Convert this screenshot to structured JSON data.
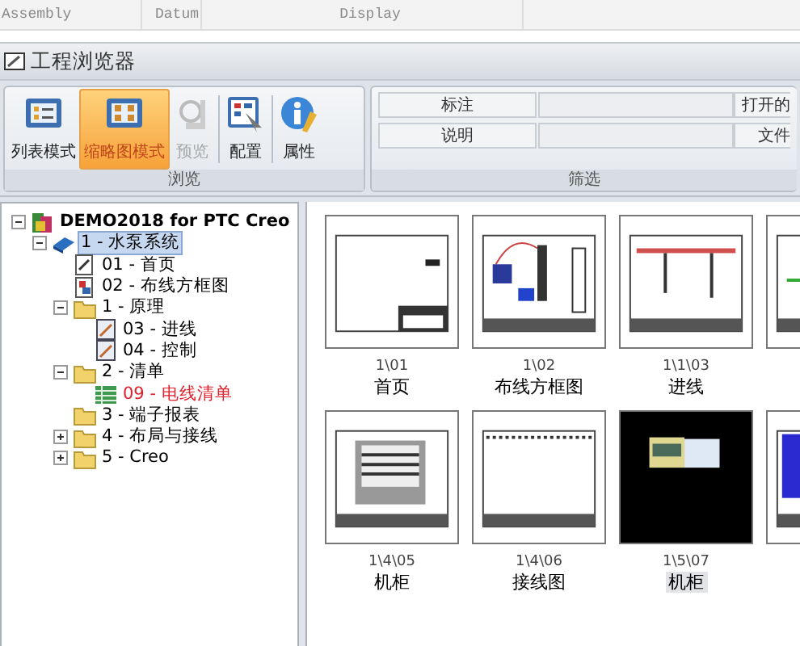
{
  "top_bar": {
    "columns": [
      "Assembly",
      "Datum",
      "Display"
    ]
  },
  "window": {
    "title": "工程浏览器"
  },
  "ribbon": {
    "browse": {
      "label": "浏览",
      "buttons": [
        {
          "label": "列表模式",
          "kind": "list",
          "selected": false,
          "disabled": false
        },
        {
          "label": "缩略图模式",
          "kind": "thumbs",
          "selected": true,
          "disabled": false
        },
        {
          "label": "预览",
          "kind": "preview",
          "selected": false,
          "disabled": true
        },
        {
          "label": "配置",
          "kind": "config",
          "selected": false,
          "disabled": false
        },
        {
          "label": "属性",
          "kind": "info",
          "selected": false,
          "disabled": false
        }
      ]
    },
    "filter": {
      "label": "筛选",
      "rows": [
        {
          "label": "标注",
          "column_3": "打开的"
        },
        {
          "label": "说明",
          "column_3": "文件"
        }
      ]
    }
  },
  "tree": [
    {
      "label": "DEMO2018 for PTC Creo",
      "kind": "project",
      "expanded": true,
      "selected": false,
      "color": "#000000",
      "children": [
        {
          "label": "1 - 水泵系统",
          "kind": "system",
          "expanded": true,
          "selected": true,
          "color": "#000000",
          "children": [
            {
              "label": "01 - 首页",
              "kind": "page",
              "selected": false,
              "color": "#000000"
            },
            {
              "label": "02 - 布线方框图",
              "kind": "diagram",
              "selected": false,
              "color": "#000000"
            },
            {
              "label": "1 - 原理",
              "kind": "folder",
              "expanded": true,
              "selected": false,
              "color": "#000000",
              "children": [
                {
                  "label": "03 - 进线",
                  "kind": "schematic",
                  "selected": false,
                  "color": "#000000"
                },
                {
                  "label": "04 - 控制",
                  "kind": "schematic",
                  "selected": false,
                  "color": "#000000"
                }
              ]
            },
            {
              "label": "2 - 清单",
              "kind": "folder",
              "expanded": true,
              "selected": false,
              "color": "#000000",
              "children": [
                {
                  "label": "09 - 电线清单",
                  "kind": "table",
                  "selected": false,
                  "color": "#e0202a"
                }
              ]
            },
            {
              "label": "3 - 端子报表",
              "kind": "folder",
              "selected": false,
              "color": "#000000"
            },
            {
              "label": "4 - 布局与接线",
              "kind": "folder",
              "expanded": false,
              "selected": false,
              "color": "#000000"
            },
            {
              "label": "5 - Creo",
              "kind": "folder",
              "expanded": false,
              "selected": false,
              "color": "#000000"
            }
          ]
        }
      ]
    }
  ],
  "thumbnails": [
    {
      "path": "1\\01",
      "title": "首页",
      "kind": "title-page",
      "selected": false
    },
    {
      "path": "1\\02",
      "title": "布线方框图",
      "kind": "block-diagram",
      "selected": false
    },
    {
      "path": "1\\1\\03",
      "title": "进线",
      "kind": "schematic",
      "selected": false
    },
    {
      "kind": "green-schematic"
    },
    {
      "path": "1\\4\\05",
      "title": "机柜",
      "kind": "cabinet",
      "selected": false
    },
    {
      "path": "1\\4\\06",
      "title": "接线图",
      "kind": "wiring",
      "selected": false
    },
    {
      "path": "1\\5\\07",
      "title": "机柜",
      "kind": "photo-sheet",
      "selected": true
    },
    {
      "kind": "blue-list"
    }
  ]
}
